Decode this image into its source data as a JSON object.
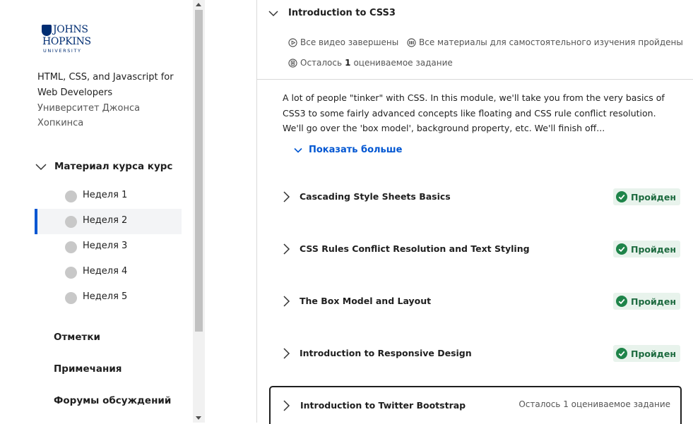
{
  "sidebar": {
    "logo": {
      "line1": "JOHNS",
      "line2": "HOPKINS",
      "line3": "UNIVERSITY"
    },
    "course_title": "HTML, CSS, and Javascript for Web Developers",
    "university": "Университет Джонса Хопкинса",
    "material_label": "Материал курса курс",
    "weeks": [
      {
        "label": "Неделя 1"
      },
      {
        "label": "Неделя 2"
      },
      {
        "label": "Неделя 3"
      },
      {
        "label": "Неделя 4"
      },
      {
        "label": "Неделя 5"
      }
    ],
    "active_week": "Неделя 2",
    "links": {
      "grades": "Отметки",
      "notes": "Примечания",
      "forums": "Форумы обсуждений"
    }
  },
  "module": {
    "title": "Introduction to CSS3",
    "videos_status": "Все видео завершены",
    "readings_status": "Все материалы для самостоятельного изучения пройдены",
    "remaining_prefix": "Осталось",
    "remaining_count": "1",
    "remaining_suffix": "оцениваемое задание",
    "description": "A lot of people \"tinker\" with CSS. In this module, we'll take you from the very basics of CSS3 to some fairly advanced concepts like floating and CSS rule conflict resolution. We'll go over the 'box model', background property, etc. We'll finish off...",
    "show_more": "Показать больше"
  },
  "lessons": [
    {
      "name": "Cascading Style Sheets Basics",
      "status": "Пройден"
    },
    {
      "name": "CSS Rules Conflict Resolution and Text Styling",
      "status": "Пройден"
    },
    {
      "name": "The Box Model and Layout",
      "status": "Пройден"
    },
    {
      "name": "Introduction to Responsive Design",
      "status": "Пройден"
    },
    {
      "name": "Introduction to Twitter Bootstrap",
      "remaining": "Осталось 1 оцениваемое задание"
    }
  ],
  "colors": {
    "accent": "#0056d2",
    "passed_bg": "#e8f3ec",
    "passed_text": "#1e6b40",
    "check": "#1e8449"
  }
}
